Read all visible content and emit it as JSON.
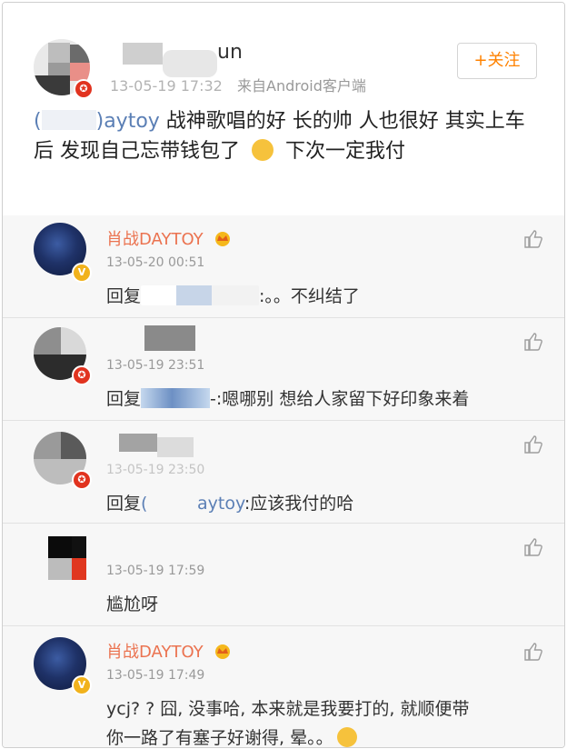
{
  "post": {
    "username": "un",
    "time": "13-05-19 17:32",
    "source": "来自Android客户端",
    "follow_label": "+关注",
    "mention": "aytoy",
    "text_1": "战神歌唱的好 长的帅 人也很好   其实上车后 发现自己忘带钱包了 ",
    "text_2": "  下次一定我付"
  },
  "comments": [
    {
      "name": "肖战DAYTOY",
      "time": "13-05-20 00:51",
      "reply_prefix": "回复",
      "reply_text": ":。。不纠结了"
    },
    {
      "name": "",
      "time": "13-05-19 23:51",
      "reply_prefix": "回复",
      "reply_text": "-:嗯哪别   想给人家留下好印象来着"
    },
    {
      "name": "",
      "time": "13-05-19 23:50",
      "reply_prefix": "回复",
      "reply_mention": "aytoy",
      "reply_text": ":应该我付的哈"
    },
    {
      "name": "",
      "time": "13-05-19 17:59",
      "text": "尴尬呀"
    },
    {
      "name": "肖战DAYTOY",
      "time": "13-05-19 17:49",
      "text_line1": "ycj? ? 囧, 没事哈, 本来就是我要打的, 就顺便带",
      "text_line2": "你一路了有塞子好谢得, 晕。。"
    }
  ],
  "colors": {
    "brand_name": "#eb7350",
    "follow": "#ff8200",
    "mention": "#5b7fb5",
    "meta": "#999999"
  }
}
